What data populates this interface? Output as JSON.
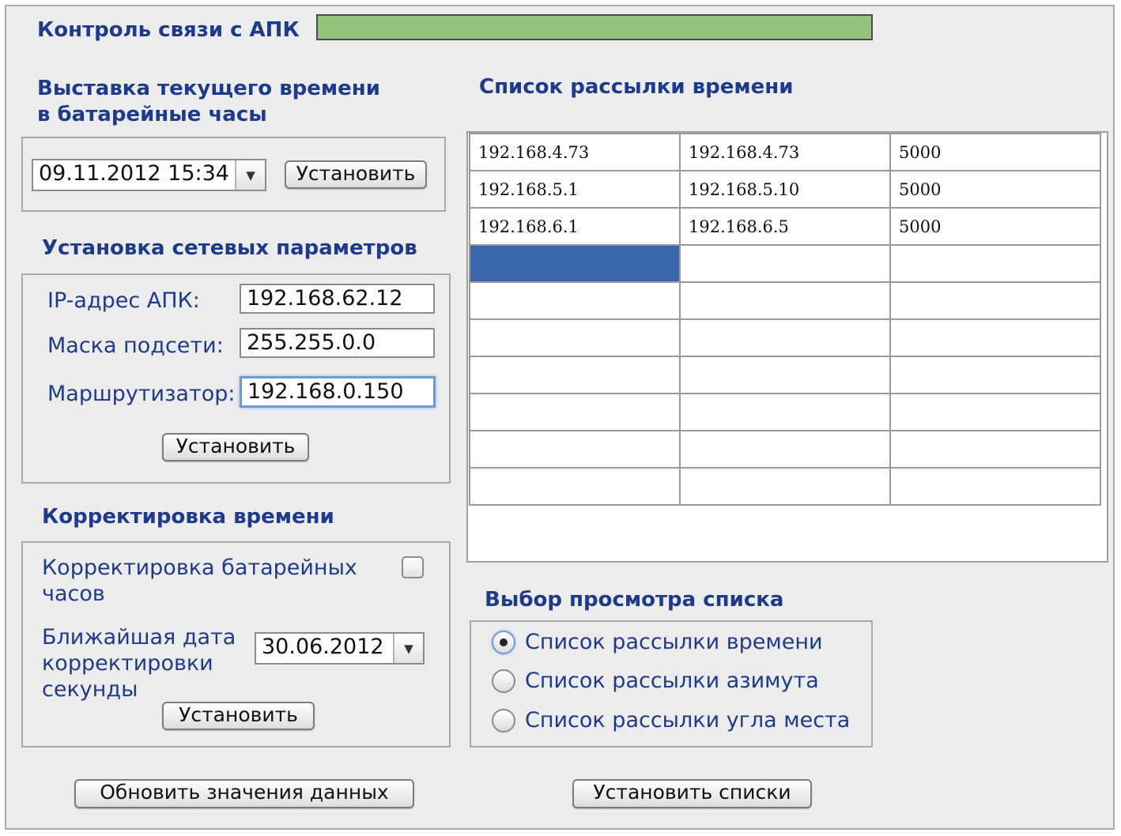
{
  "link_control": {
    "title": "Контроль связи с АПК",
    "status_color": "#93c47d"
  },
  "clock": {
    "heading": "Выставка текущего времени\nв батарейные часы",
    "datetime": "09.11.2012 15:34",
    "button": "Установить"
  },
  "network": {
    "heading": "Установка сетевых параметров",
    "ip_label": "IP-адрес АПК:",
    "ip_value": "192.168.62.12",
    "mask_label": "Маска подсети:",
    "mask_value": "255.255.0.0",
    "router_label": "Маршрутизатор:",
    "router_value": "192.168.0.150",
    "button": "Установить"
  },
  "correction": {
    "heading": "Корректировка времени",
    "battery_label": "Корректировка батарейных\nчасов",
    "battery_checked": false,
    "date_label": "Ближайшая дата\nкорректировки\nсекунды",
    "date_value": "30.06.2012",
    "button": "Установить"
  },
  "list": {
    "heading": "Список рассылки времени",
    "rows": [
      [
        "192.168.4.73",
        "192.168.4.73",
        "5000"
      ],
      [
        "192.168.5.1",
        "192.168.5.10",
        "5000"
      ],
      [
        "192.168.6.1",
        "192.168.6.5",
        "5000"
      ],
      [
        "",
        "",
        ""
      ],
      [
        "",
        "",
        ""
      ],
      [
        "",
        "",
        ""
      ],
      [
        "",
        "",
        ""
      ],
      [
        "",
        "",
        ""
      ],
      [
        "",
        "",
        ""
      ],
      [
        "",
        "",
        ""
      ]
    ],
    "selected_row": 3,
    "selected_col": 0
  },
  "view_select": {
    "heading": "Выбор просмотра списка",
    "options": [
      {
        "label": "Список рассылки времени",
        "checked": true
      },
      {
        "label": "Список рассылки азимута",
        "checked": false
      },
      {
        "label": "Список рассылки угла места",
        "checked": false
      }
    ]
  },
  "footer": {
    "refresh_button": "Обновить значения данных",
    "set_lists_button": "Установить списки"
  }
}
